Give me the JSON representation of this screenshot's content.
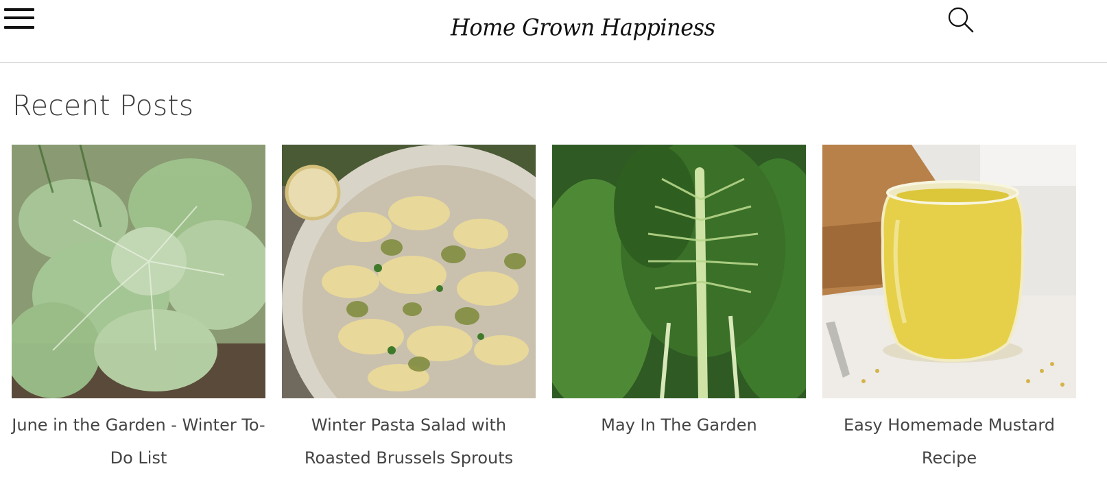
{
  "header": {
    "logo_text": "Home Grown Happiness",
    "menu_icon": "hamburger-menu-icon",
    "search_icon": "search-icon"
  },
  "main": {
    "section_title": "Recent Posts",
    "posts": [
      {
        "title": "June in the Garden - Winter To-Do List",
        "image": "cabbage-leaves-photo"
      },
      {
        "title": "Winter Pasta Salad with Roasted Brussels Sprouts",
        "image": "pasta-salad-bowl-photo"
      },
      {
        "title": "May In The Garden",
        "image": "swiss-chard-leaves-photo"
      },
      {
        "title": "Easy Homemade Mustard Recipe",
        "image": "mustard-jar-photo"
      }
    ]
  }
}
